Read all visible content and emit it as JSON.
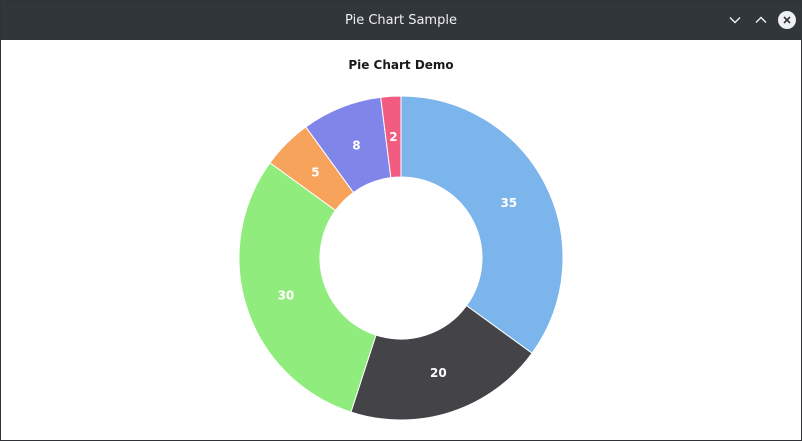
{
  "window": {
    "title": "Pie Chart Sample",
    "titlebar_color": "#31363b"
  },
  "buttons": {
    "minimize_icon": "chevron-down-icon",
    "maximize_icon": "chevron-up-icon",
    "close_icon": "close-icon"
  },
  "chart_data": {
    "type": "pie",
    "style": "donut",
    "title": "Pie Chart Demo",
    "categories": [
      "",
      "",
      "",
      "",
      "",
      ""
    ],
    "values": [
      35,
      20,
      30,
      5,
      8,
      2
    ],
    "labels": [
      "35",
      "20",
      "30",
      "5",
      "8",
      "2"
    ],
    "colors": [
      "#7cb5ec",
      "#434348",
      "#90ed7d",
      "#f7a35c",
      "#8085e9",
      "#f15c80"
    ],
    "start_angle_deg": 0,
    "direction": "clockwise",
    "legend": "none"
  }
}
